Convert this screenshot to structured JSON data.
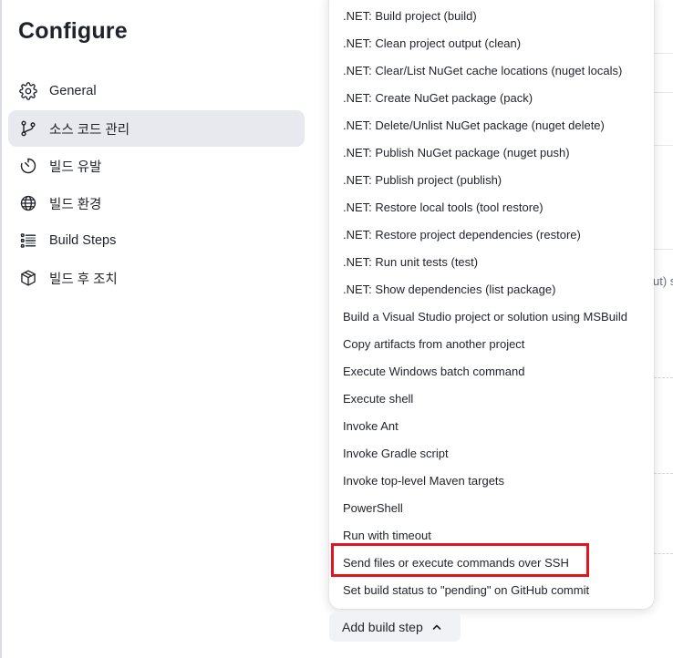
{
  "page": {
    "title": "Configure"
  },
  "nav": {
    "items": [
      {
        "label": "General",
        "icon": "gear-icon"
      },
      {
        "label": "소스 코드 관리",
        "icon": "git-branch-icon",
        "active": true
      },
      {
        "label": "빌드 유발",
        "icon": "timer-icon"
      },
      {
        "label": "빌드 환경",
        "icon": "globe-icon"
      },
      {
        "label": "Build Steps",
        "icon": "list-icon"
      },
      {
        "label": "빌드 후 조치",
        "icon": "package-icon"
      }
    ]
  },
  "background": {
    "fragment_text": "ut) s"
  },
  "menu": {
    "items": [
      ".NET: Build project (build)",
      ".NET: Clean project output (clean)",
      ".NET: Clear/List NuGet cache locations (nuget locals)",
      ".NET: Create NuGet package (pack)",
      ".NET: Delete/Unlist NuGet package (nuget delete)",
      ".NET: Publish NuGet package (nuget push)",
      ".NET: Publish project (publish)",
      ".NET: Restore local tools (tool restore)",
      ".NET: Restore project dependencies (restore)",
      ".NET: Run unit tests (test)",
      ".NET: Show dependencies (list package)",
      "Build a Visual Studio project or solution using MSBuild",
      "Copy artifacts from another project",
      "Execute Windows batch command",
      "Execute shell",
      "Invoke Ant",
      "Invoke Gradle script",
      "Invoke top-level Maven targets",
      "PowerShell",
      "Run with timeout",
      "Send files or execute commands over SSH",
      "Set build status to \"pending\" on GitHub commit"
    ],
    "highlighted_item": "Send files or execute commands over SSH",
    "highlight_color": "#e3141f"
  },
  "add_build_step": {
    "label": "Add build step",
    "icon": "chevron-up-icon"
  }
}
